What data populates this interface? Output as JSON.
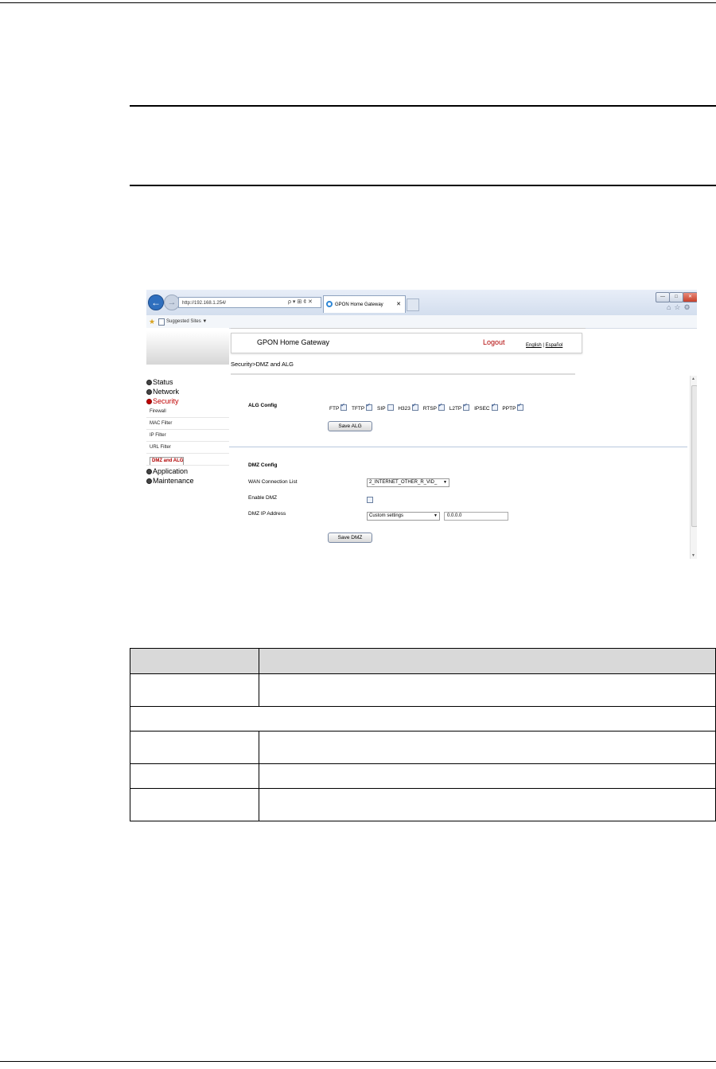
{
  "browser": {
    "url": "http://192.168.1.254/",
    "address_tools": "ρ ▾ ⊞ ¢ ✕",
    "tab_title": "GPON Home Gateway",
    "favorites_label": "Suggested Sites ▼",
    "window_min": "—",
    "window_max": "□",
    "window_close": "✕"
  },
  "gateway": {
    "product_name": "GPON Home Gateway",
    "logout": "Logout",
    "lang_english": "English",
    "lang_separator": "|",
    "lang_spanish": "Español",
    "breadcrumb": "Security>DMZ and ALG"
  },
  "menu": {
    "status": "Status",
    "network": "Network",
    "security": "Security",
    "security_items": [
      "Firewall",
      "MAC Filter",
      "IP Filter",
      "URL Filter",
      "DMZ and ALG"
    ],
    "application": "Application",
    "maintenance": "Maintenance"
  },
  "alg": {
    "title": "ALG Config",
    "protocols": [
      {
        "label": "FTP",
        "checked": true
      },
      {
        "label": "TFTP",
        "checked": true
      },
      {
        "label": "SIP",
        "checked": false
      },
      {
        "label": "H323",
        "checked": true
      },
      {
        "label": "RTSP",
        "checked": true
      },
      {
        "label": "L2TP",
        "checked": true
      },
      {
        "label": "IPSEC",
        "checked": true
      },
      {
        "label": "PPTP",
        "checked": true
      }
    ],
    "save_label": "Save ALG"
  },
  "dmz": {
    "title": "DMZ Config",
    "wan_label": "WAN Connection List",
    "wan_value": "2_INTERNET_OTHER_R_VID_",
    "enable_label": "Enable DMZ",
    "enable_checked": false,
    "ip_label": "DMZ IP Address",
    "ip_mode": "Custom settings",
    "ip_value": "0.0.0.0",
    "save_label": "Save DMZ"
  },
  "table": {
    "rows": [
      [
        "",
        ""
      ],
      [
        "",
        ""
      ],
      [
        ""
      ],
      [
        "",
        ""
      ],
      [
        "",
        ""
      ],
      [
        "",
        ""
      ]
    ]
  }
}
